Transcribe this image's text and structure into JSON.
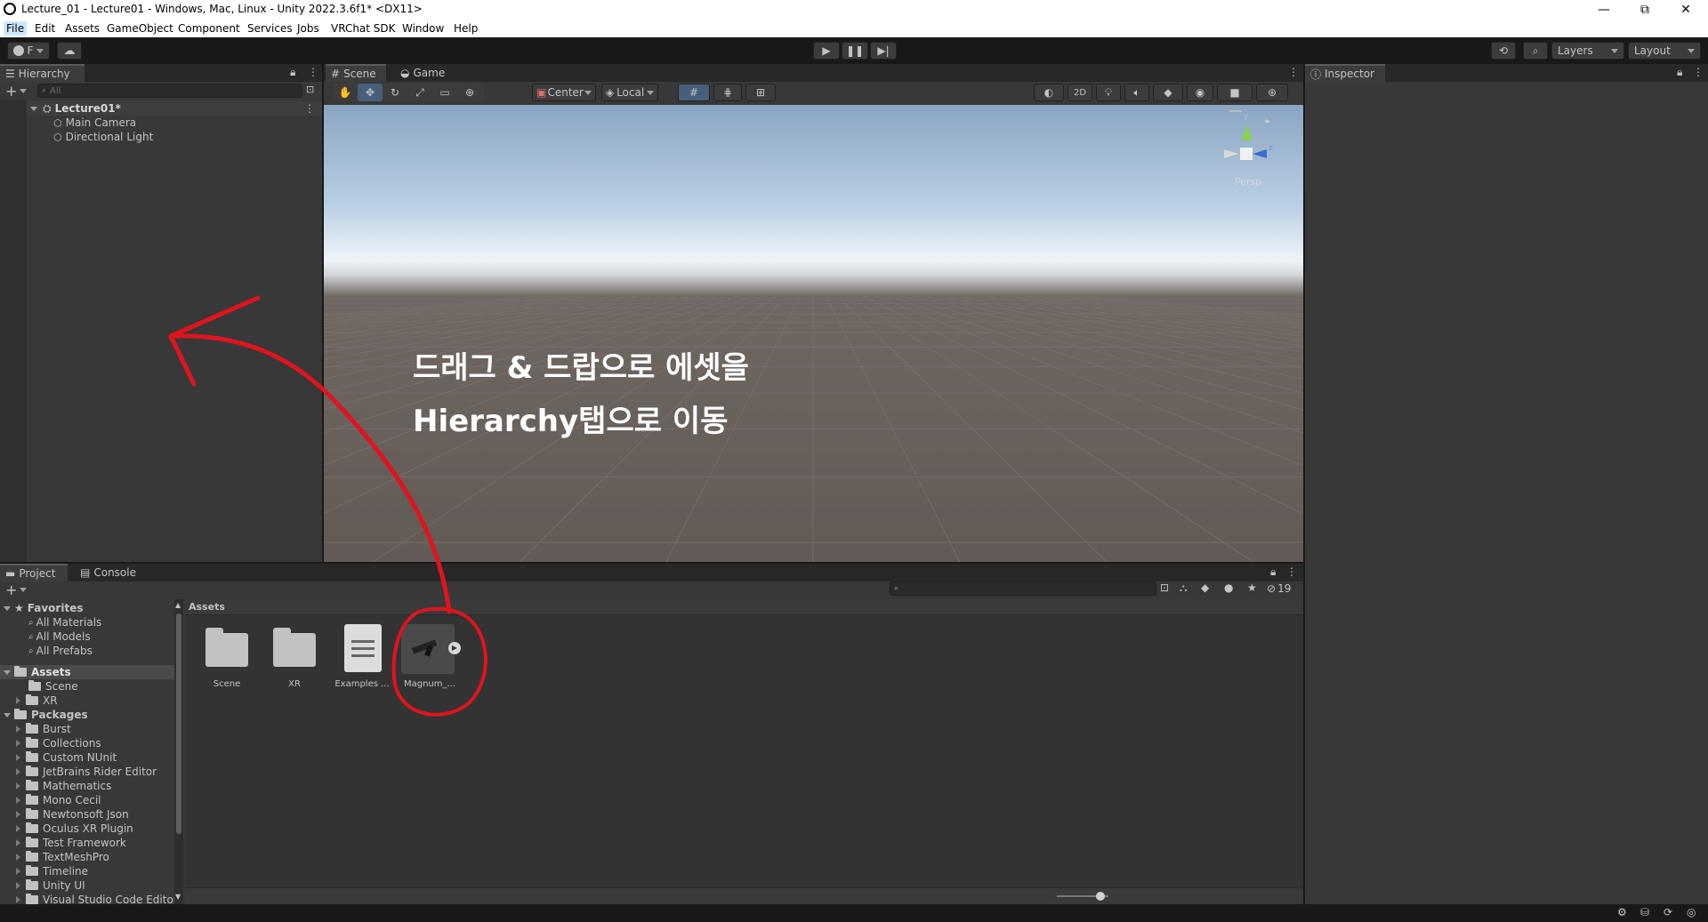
{
  "window": {
    "title": "Lecture_01 - Lecture01 - Windows, Mac, Linux - Unity 2022.3.6f1* <DX11>",
    "minimize": "—",
    "maximize": "⧉",
    "close": "✕"
  },
  "menu": [
    "File",
    "Edit",
    "Assets",
    "GameObject",
    "Component",
    "Services",
    "Jobs",
    "VRChat SDK",
    "Window",
    "Help"
  ],
  "toolbar": {
    "account_label": "F",
    "layers_label": "Layers",
    "layout_label": "Layout"
  },
  "hierarchy": {
    "tab": "Hierarchy",
    "search_placeholder": "All",
    "scene": "Lecture01*",
    "items": [
      "Main Camera",
      "Directional Light"
    ]
  },
  "scene_panel": {
    "tabs": [
      "Scene",
      "Game"
    ],
    "pivot": "Center",
    "space": "Local",
    "mode_2d": "2D",
    "persp": "Persp",
    "gizmo_y": "y",
    "gizmo_z": "z"
  },
  "inspector": {
    "tab": "Inspector"
  },
  "project": {
    "tabs": [
      "Project",
      "Console"
    ],
    "breadcrumb": "Assets",
    "hidden_count": "19",
    "favorites_label": "Favorites",
    "favorites": [
      "All Materials",
      "All Models",
      "All Prefabs"
    ],
    "assets_label": "Assets",
    "assets_tree": [
      "Scene",
      "XR"
    ],
    "packages_label": "Packages",
    "packages": [
      "Burst",
      "Collections",
      "Custom NUnit",
      "JetBrains Rider Editor",
      "Mathematics",
      "Mono Cecil",
      "Newtonsoft Json",
      "Oculus XR Plugin",
      "Test Framework",
      "TextMeshPro",
      "Timeline",
      "Unity UI",
      "Visual Studio Code Editor"
    ],
    "grid_items": [
      "Scene",
      "XR",
      "Examples ...",
      "Magnum_..."
    ]
  },
  "annotation": {
    "line1": "드래그 & 드랍으로 에셋을",
    "line2": "Hierarchy탭으로 이동",
    "color": "#e0141c"
  }
}
